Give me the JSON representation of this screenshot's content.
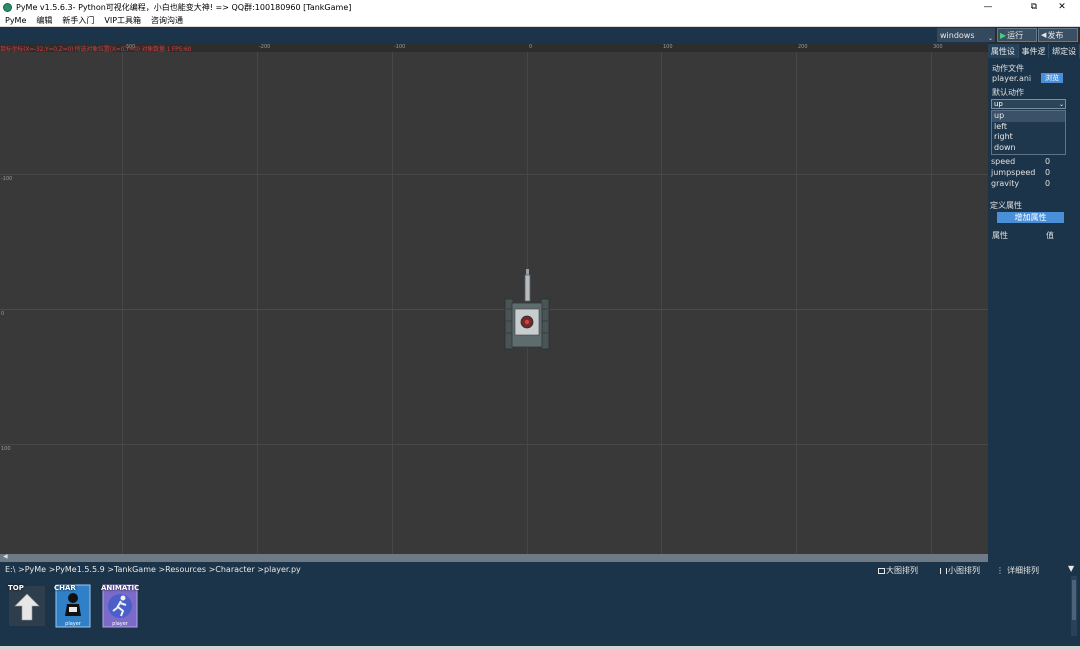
{
  "title_bar": {
    "title": "PyMe v1.5.6.3- Python可视化编程，小白也能变大神!   => QQ群:100180960   [TankGame]",
    "minimize": "—",
    "maximize": "⧉",
    "close": "✕"
  },
  "menu": {
    "items": [
      "PyMe",
      "编辑",
      "新手入门",
      "VIP工具箱",
      "咨询沟通"
    ]
  },
  "toolbar": {
    "platform": "windows",
    "run_label": "运行",
    "publish_label": "发布"
  },
  "scene": {
    "debug_text": "鼠标坐标(X=-32,Y=0,Z=0) 所选对象位置(X=0,Y=0) 对象数量:1 FPS:60",
    "ruler_top": [
      "-300",
      "-200",
      "-100",
      "0",
      "100",
      "200",
      "300"
    ],
    "ruler_left": [
      "-100",
      "0",
      "100"
    ]
  },
  "right_panel": {
    "tabs": [
      "属性设",
      "事件逻",
      "绑定设"
    ],
    "action_file_label": "动作文件",
    "action_file_value": "player.ani",
    "browse_label": "浏览",
    "default_action_label": "默认动作",
    "default_action_value": "up",
    "animation_options": [
      "up",
      "left",
      "right",
      "down"
    ],
    "properties": [
      {
        "name": "speed",
        "value": "0"
      },
      {
        "name": "jumpspeed",
        "value": "0"
      },
      {
        "name": "gravity",
        "value": "0"
      }
    ],
    "custom_attr_label": "定义属性",
    "add_attr_button": "增加属性",
    "attr_col_header": "属性",
    "value_col_header": "值"
  },
  "bottom_panel": {
    "breadcrumb": "E:\\ >PyMe >PyMe1.5.5.9 >TankGame >Resources >Character >player.py",
    "view_options": [
      "大图排列",
      "小图排列",
      "详细排列"
    ],
    "files": [
      {
        "label": "TOP",
        "sub": "",
        "icon": "up-arrow-icon"
      },
      {
        "label": "CHAR",
        "sub": "player",
        "icon": "character-icon"
      },
      {
        "label": "ANIMATIC",
        "sub": "player",
        "icon": "animation-icon"
      }
    ]
  },
  "colors": {
    "panel_bg": "#1c3449",
    "scene_bg": "#393939",
    "accent_blue": "#4a90d8",
    "axis_red": "#8a3030",
    "axis_blue": "#3a3aa0"
  }
}
